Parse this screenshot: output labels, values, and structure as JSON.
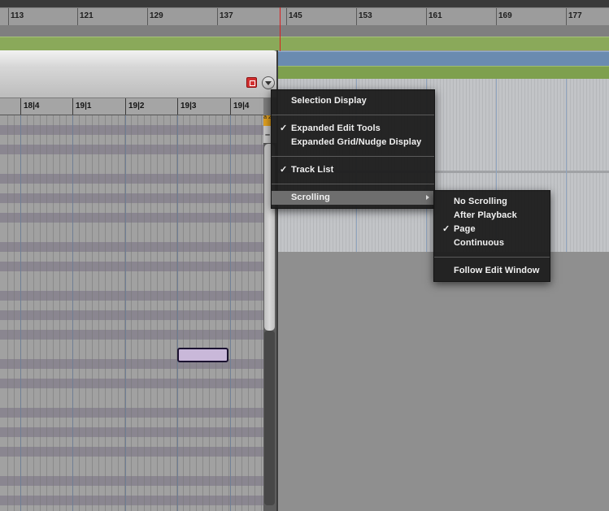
{
  "top_ruler": {
    "bars": [
      "113",
      "121",
      "129",
      "137",
      "145",
      "153",
      "161",
      "169",
      "177"
    ]
  },
  "midi_editor": {
    "ruler": {
      "beats": [
        "18|4",
        "19|1",
        "19|2",
        "19|3",
        "19|4"
      ]
    },
    "zoom_badge": "a 2",
    "zoom_minus": "–"
  },
  "context_menu": {
    "items": [
      {
        "label": "Selection Display",
        "checked": false
      },
      {
        "label": "Expanded Edit Tools",
        "checked": true
      },
      {
        "label": "Expanded Grid/Nudge Display",
        "checked": false
      },
      {
        "label": "Track List",
        "checked": true
      },
      {
        "label": "Scrolling",
        "checked": false,
        "submenu": true,
        "highlighted": true
      }
    ],
    "check_glyph": "✓"
  },
  "scrolling_submenu": {
    "items": [
      {
        "label": "No Scrolling",
        "checked": false
      },
      {
        "label": "After Playback",
        "checked": false
      },
      {
        "label": "Page",
        "checked": true
      },
      {
        "label": "Continuous",
        "checked": false
      },
      {
        "label": "Follow Edit Window",
        "checked": false
      }
    ]
  },
  "colors": {
    "track_green": "#8aa95a",
    "track_blue": "#6a8bb0",
    "menu_bg": "#1e1e1e",
    "menu_highlight": "#6e6e6e",
    "playhead": "#d82020",
    "midi_note": "#c9b8d9"
  },
  "icons": {
    "stop": "stop-square-icon",
    "menu": "chevron-down-circle-icon",
    "submenu_arrow": "triangle-right-icon"
  }
}
